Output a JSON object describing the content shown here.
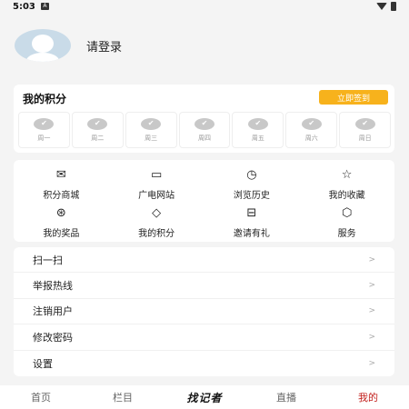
{
  "status_bar": {
    "time": "5:03",
    "notification_icon": "A"
  },
  "profile": {
    "login_text": "请登录"
  },
  "points": {
    "title": "我的积分",
    "checkin_label": "立即签到",
    "days": [
      {
        "label": "周一",
        "icon": "check-icon"
      },
      {
        "label": "周二",
        "icon": "check-icon"
      },
      {
        "label": "周三",
        "icon": "check-icon"
      },
      {
        "label": "周四",
        "icon": "check-icon"
      },
      {
        "label": "周五",
        "icon": "check-icon"
      },
      {
        "label": "周六",
        "icon": "check-icon"
      },
      {
        "label": "周日",
        "icon": "check-icon"
      }
    ]
  },
  "grid": {
    "items": [
      {
        "label": "积分商城",
        "icon": "envelope-icon",
        "glyph": "✉"
      },
      {
        "label": "广电网站",
        "icon": "monitor-icon",
        "glyph": "▭"
      },
      {
        "label": "浏览历史",
        "icon": "clock-icon",
        "glyph": "◷"
      },
      {
        "label": "我的收藏",
        "icon": "star-icon",
        "glyph": "☆"
      },
      {
        "label": "我的奖品",
        "icon": "prize-icon",
        "glyph": "⊛"
      },
      {
        "label": "我的积分",
        "icon": "diamond-icon",
        "glyph": "◇"
      },
      {
        "label": "邀请有礼",
        "icon": "gift-icon",
        "glyph": "⊟"
      },
      {
        "label": "服务",
        "icon": "cube-icon",
        "glyph": "⬡"
      }
    ]
  },
  "menu": {
    "items": [
      {
        "label": "扫一扫",
        "chevron": ">"
      },
      {
        "label": "举报热线",
        "chevron": ">"
      },
      {
        "label": "注销用户",
        "chevron": ">"
      },
      {
        "label": "修改密码",
        "chevron": ">"
      },
      {
        "label": "设置",
        "chevron": ">"
      }
    ]
  },
  "bottom_nav": {
    "home": "首页",
    "columns": "栏目",
    "logo": "找记者",
    "live": "直播",
    "mine": "我的"
  }
}
